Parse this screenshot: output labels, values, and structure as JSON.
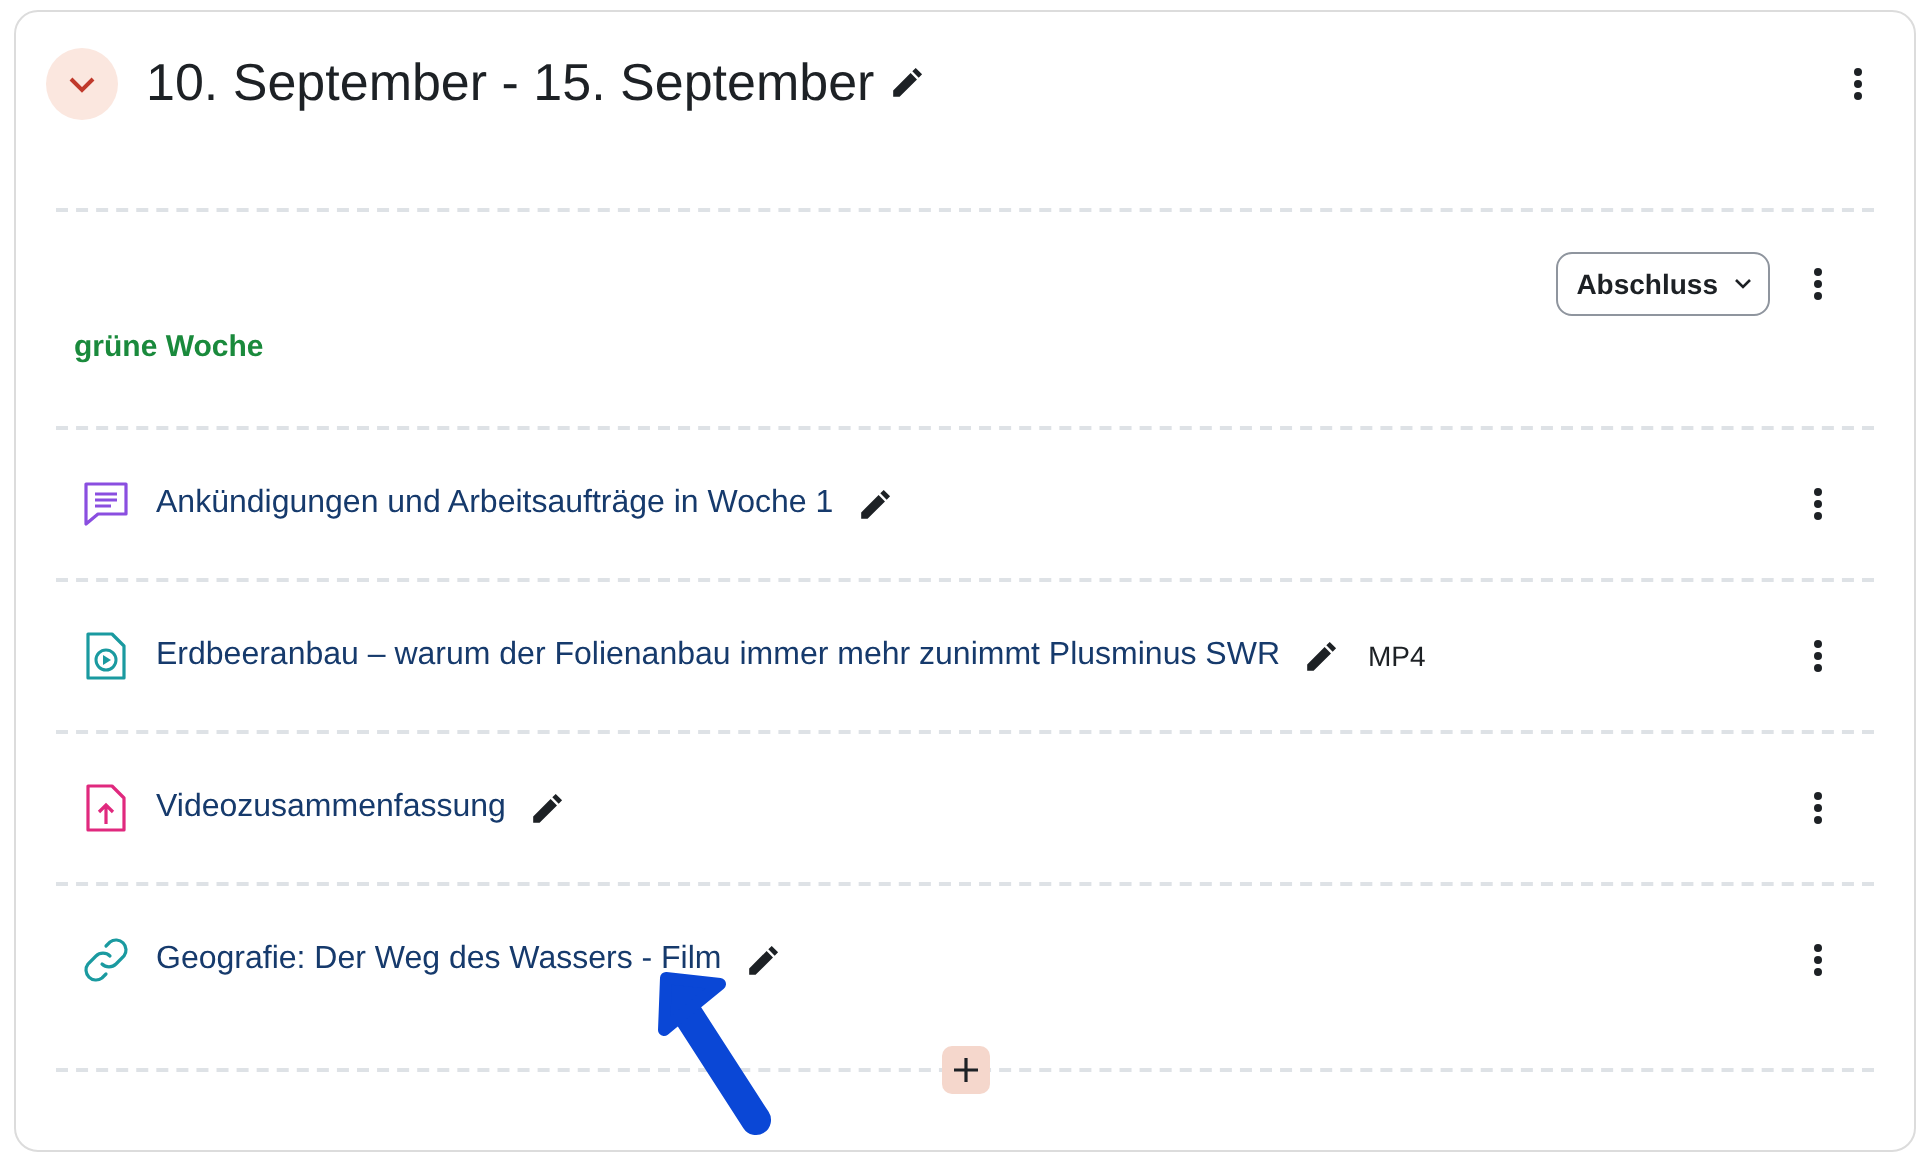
{
  "section": {
    "title": "10. September - 15. September",
    "expanded": true,
    "completion_button": "Abschluss",
    "summary": "grüne Woche"
  },
  "activities": [
    {
      "kind": "forum",
      "title": "Ankündigungen und Arbeitsaufträge in Woche 1"
    },
    {
      "kind": "video",
      "title": "Erdbeeranbau – warum der Folienanbau immer mehr zunimmt Plusminus SWR",
      "file_type": "MP4"
    },
    {
      "kind": "upload",
      "title": "Videozusammenfassung"
    },
    {
      "kind": "url",
      "title": "Geografie: Der Weg des Wassers - Film"
    }
  ],
  "annotation_arrow": true
}
